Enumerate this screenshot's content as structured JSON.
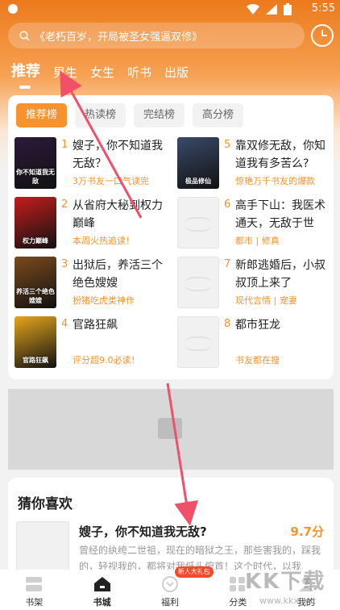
{
  "status": {
    "time": "5:55"
  },
  "search": {
    "placeholder": "《老朽百岁，开局被圣女强逼双修》"
  },
  "tabs": [
    "推荐",
    "男生",
    "女生",
    "听书",
    "出版"
  ],
  "rank_tabs": [
    "推荐榜",
    "热读榜",
    "完结榜",
    "高分榜"
  ],
  "rank_left": [
    {
      "rank": "1",
      "title": "嫂子，你不知道我无敌？",
      "sub": "3万书友一口气读完",
      "cover": "你不知道我无敌",
      "color": "#2b1a3a"
    },
    {
      "rank": "2",
      "title": "从省府大秘到权力巅峰",
      "sub": "本周火热追读！",
      "cover": "权力巅峰",
      "color": "#c41d1d"
    },
    {
      "rank": "3",
      "title": "出狱后，养活三个绝色嫂嫂",
      "sub": "扮猪吃虎类神作",
      "cover": "养活三个绝色嫂嫂",
      "color": "#7b4a1d"
    },
    {
      "rank": "4",
      "title": "官路狂飙",
      "sub": "评分超9.0必读！",
      "cover": "官路狂飙",
      "color": "#e5a61d"
    }
  ],
  "rank_right": [
    {
      "rank": "5",
      "title": "靠双修无敌，你知道我有多苦么?",
      "sub": "惊艳万千书友的爆款",
      "cover": "极品修仙",
      "color": "#3a4a6a"
    },
    {
      "rank": "6",
      "title": "高手下山：我医术通天，无敌于世",
      "sub": "都市 | 修真",
      "cover": "",
      "color": ""
    },
    {
      "rank": "7",
      "title": "新郎逃婚后，小叔叔顶上来了",
      "sub": "现代言情 | 宠妻",
      "cover": "",
      "color": ""
    },
    {
      "rank": "8",
      "title": "都市狂龙",
      "sub": "书友都在搜",
      "cover": "",
      "color": ""
    }
  ],
  "guess": {
    "title": "猜你喜欢",
    "book": "嫂子，你不知道我无敌?",
    "score": "9.7分",
    "desc": "曾经的纨绔二世祖，现在的暗狱之王，那些害我的，踩我的，轻视我的，都将对我低头俯首！这个时代，以我"
  },
  "nav": [
    {
      "label": "书架",
      "badge": ""
    },
    {
      "label": "书城",
      "badge": ""
    },
    {
      "label": "福利",
      "badge": "新人大礼包"
    },
    {
      "label": "分类",
      "badge": ""
    },
    {
      "label": "我的",
      "badge": ""
    }
  ],
  "watermark": {
    "main": "KK下载",
    "sub": "www.kkx.net"
  },
  "colors": {
    "accent": "#f7922c",
    "header": "#ec7a1c",
    "arrow": "#f0506a"
  }
}
